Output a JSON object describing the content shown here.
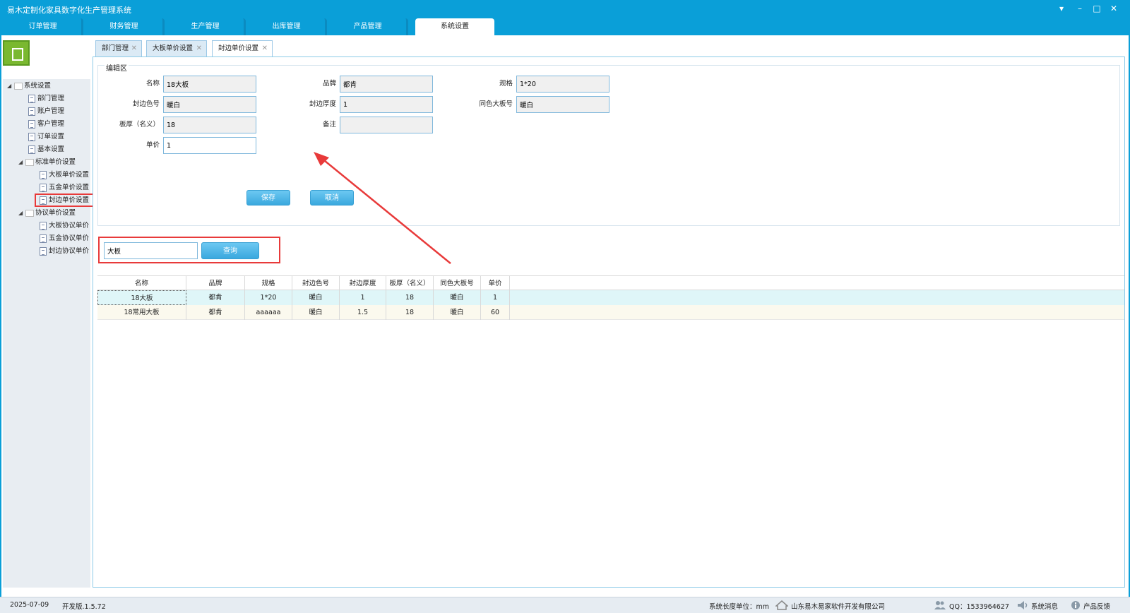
{
  "app": {
    "title": "易木定制化家具数字化生产管理系统",
    "window_controls": {
      "dropdown": "▾",
      "minimize": "–",
      "maximize": "□",
      "close": "✕"
    }
  },
  "main_tabs": [
    {
      "label": "订单管理"
    },
    {
      "label": "财务管理"
    },
    {
      "label": "生产管理"
    },
    {
      "label": "出库管理"
    },
    {
      "label": "产品管理"
    },
    {
      "label": "系统设置",
      "active": true
    }
  ],
  "sidebar": {
    "root": "系统设置",
    "items": [
      "部门管理",
      "账户管理",
      "客户管理",
      "订单设置",
      "基本设置"
    ],
    "standard_group": "标准单价设置",
    "standard_items": [
      "大板单价设置",
      "五金单价设置",
      "封边单价设置"
    ],
    "agreement_group": "协议单价设置",
    "agreement_items": [
      "大板协议单价",
      "五金协议单价",
      "封边协议单价"
    ]
  },
  "sub_tabs": [
    {
      "label": "部门管理",
      "close": "✕"
    },
    {
      "label": "大板单价设置",
      "close": "✕"
    },
    {
      "label": "封边单价设置",
      "close": "✕",
      "active": true
    }
  ],
  "edit_area": {
    "legend": "编辑区",
    "fields": {
      "name": {
        "label": "名称",
        "value": "18大板"
      },
      "brand": {
        "label": "品牌",
        "value": "都肯"
      },
      "spec": {
        "label": "规格",
        "value": "1*20"
      },
      "edge_color": {
        "label": "封边色号",
        "value": "暖白"
      },
      "edge_thickness": {
        "label": "封边厚度",
        "value": "1"
      },
      "same_color_board": {
        "label": "同色大板号",
        "value": "暖白"
      },
      "board_thickness": {
        "label": "板厚（名义）",
        "value": "18"
      },
      "remark": {
        "label": "备注",
        "value": ""
      },
      "unit_price": {
        "label": "单价",
        "value": "1"
      }
    },
    "save_label": "保存",
    "cancel_label": "取消"
  },
  "search": {
    "value": "大板",
    "button_label": "查询"
  },
  "table": {
    "columns": [
      "名称",
      "品牌",
      "规格",
      "封边色号",
      "封边厚度",
      "板厚（名义）",
      "同色大板号",
      "单价"
    ],
    "rows": [
      [
        "18大板",
        "都肯",
        "1*20",
        "暖白",
        "1",
        "18",
        "暖白",
        "1"
      ],
      [
        "18常用大板",
        "都肯",
        "aaaaaa",
        "暖白",
        "1.5",
        "18",
        "暖白",
        "60"
      ]
    ]
  },
  "status_bar": {
    "date": "2025-07-09",
    "version": "开发版.1.5.72",
    "length_unit": "系统长度单位：mm",
    "company": "山东易木易家软件开发有限公司",
    "qq": "QQ：1533964627",
    "messages": "系统消息",
    "feedback": "产品反馈"
  },
  "colors": {
    "accent": "#0a9fd8",
    "button": "#3aa8de",
    "annotation": "#e83a3a",
    "selected_row": "#dff6f8"
  }
}
